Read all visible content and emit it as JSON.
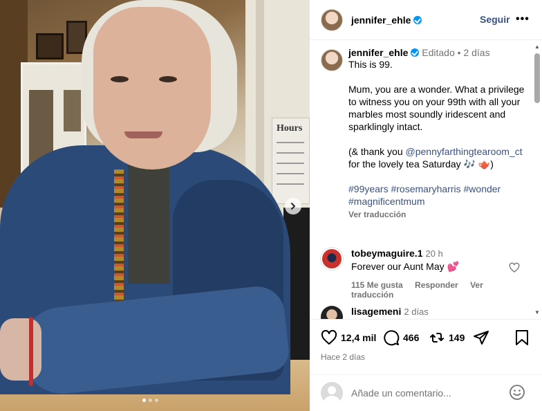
{
  "post": {
    "author": "jennifer_ehle",
    "follow_label": "Seguir",
    "more_label": "•••",
    "edited": "Editado",
    "separator": "•",
    "age": "2 días",
    "caption_intro": "This is 99.\n\nMum, you are a wonder. What a privilege to witness you on your 99th with all your marbles most soundly iridescent and sparklingly intact.\n\n(& thank you ",
    "caption_mention": "@pennyfarthingtearoom_ct",
    "caption_outro": " for the lovely tea Saturday 🎶 🫖)",
    "hashtags": "#99years #rosemaryharris #wonder #magnificentmum",
    "see_translation": "Ver traducción",
    "photo_sign_text": "Hours"
  },
  "comments": [
    {
      "user": "tobeymaguire.1",
      "time": "20 h",
      "text": "Forever our Aunt May 💕",
      "likes": "115 Me gusta",
      "reply": "Responder",
      "translate": "Ver traducción"
    },
    {
      "user": "lisagemeni",
      "time": "2 días"
    }
  ],
  "stats": {
    "likes": "12,4 mil",
    "comments": "466",
    "reposts": "149",
    "timestamp": "Hace 2 días"
  },
  "comment_box": {
    "placeholder": "Añade un comentario..."
  },
  "carousel": {
    "slides": 3,
    "active": 1
  },
  "colors": {
    "link": "#385185",
    "verified": "#0095f6",
    "muted": "#737373"
  }
}
